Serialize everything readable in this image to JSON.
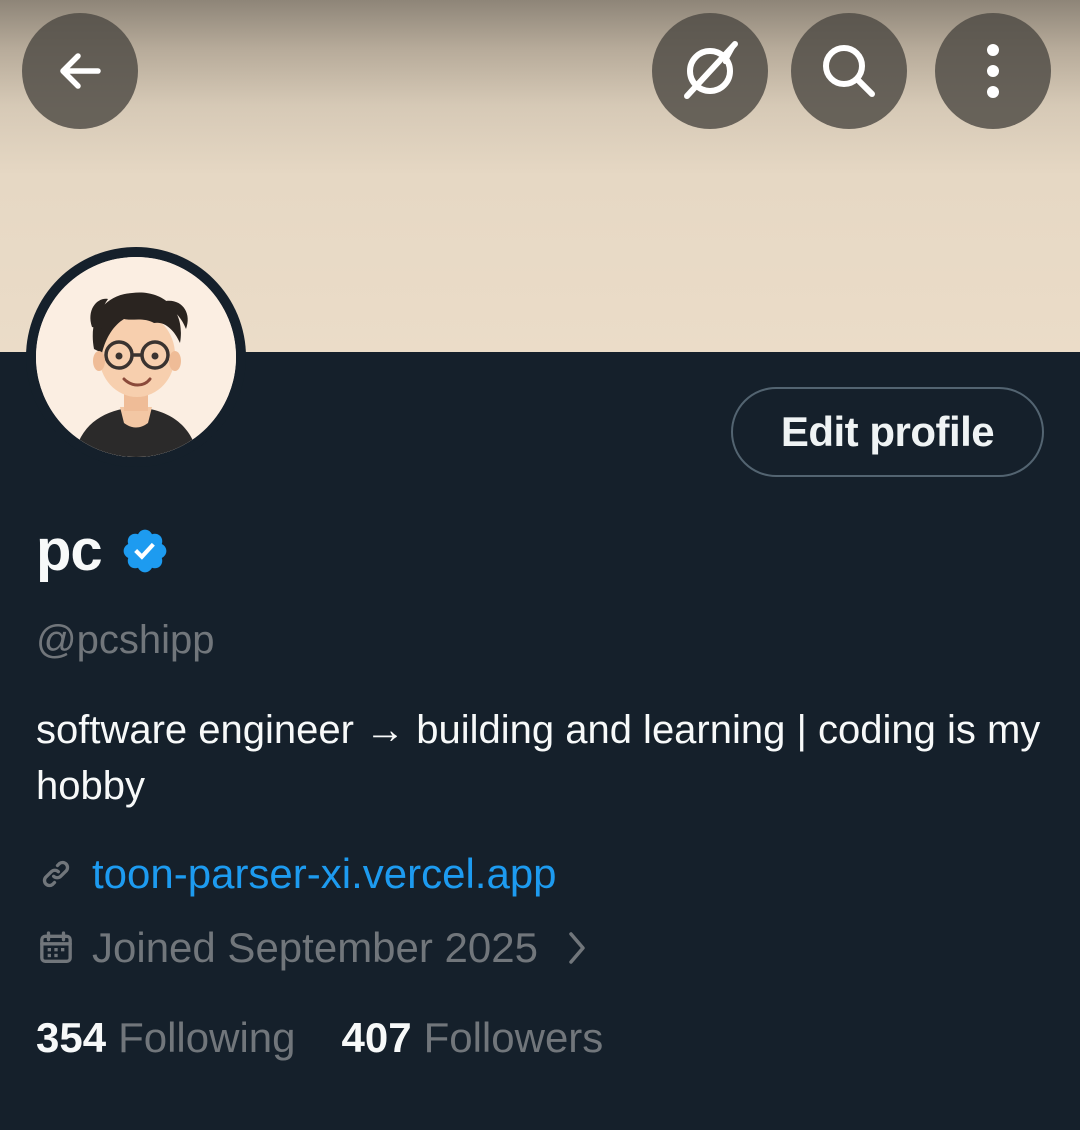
{
  "header": {
    "back_icon": "arrow-left-icon",
    "grok_icon": "grok-icon",
    "search_icon": "search-icon",
    "more_icon": "more-vertical-icon",
    "banner_colors": [
      "#8e8578",
      "#ebdcc8"
    ]
  },
  "profile": {
    "name": "pc",
    "verified": true,
    "verified_color": "#1d9bf0",
    "handle": "@pcshipp",
    "bio": "software engineer → building and learning | coding is my hobby",
    "link": "toon-parser-xi.vercel.app",
    "joined": "Joined September 2025"
  },
  "actions": {
    "edit_profile_label": "Edit profile"
  },
  "stats": {
    "following_count": "354",
    "following_label": "Following",
    "followers_count": "407",
    "followers_label": "Followers"
  },
  "colors": {
    "background": "#15202b",
    "accent": "#1d9bf0",
    "muted_text": "#71767b"
  }
}
